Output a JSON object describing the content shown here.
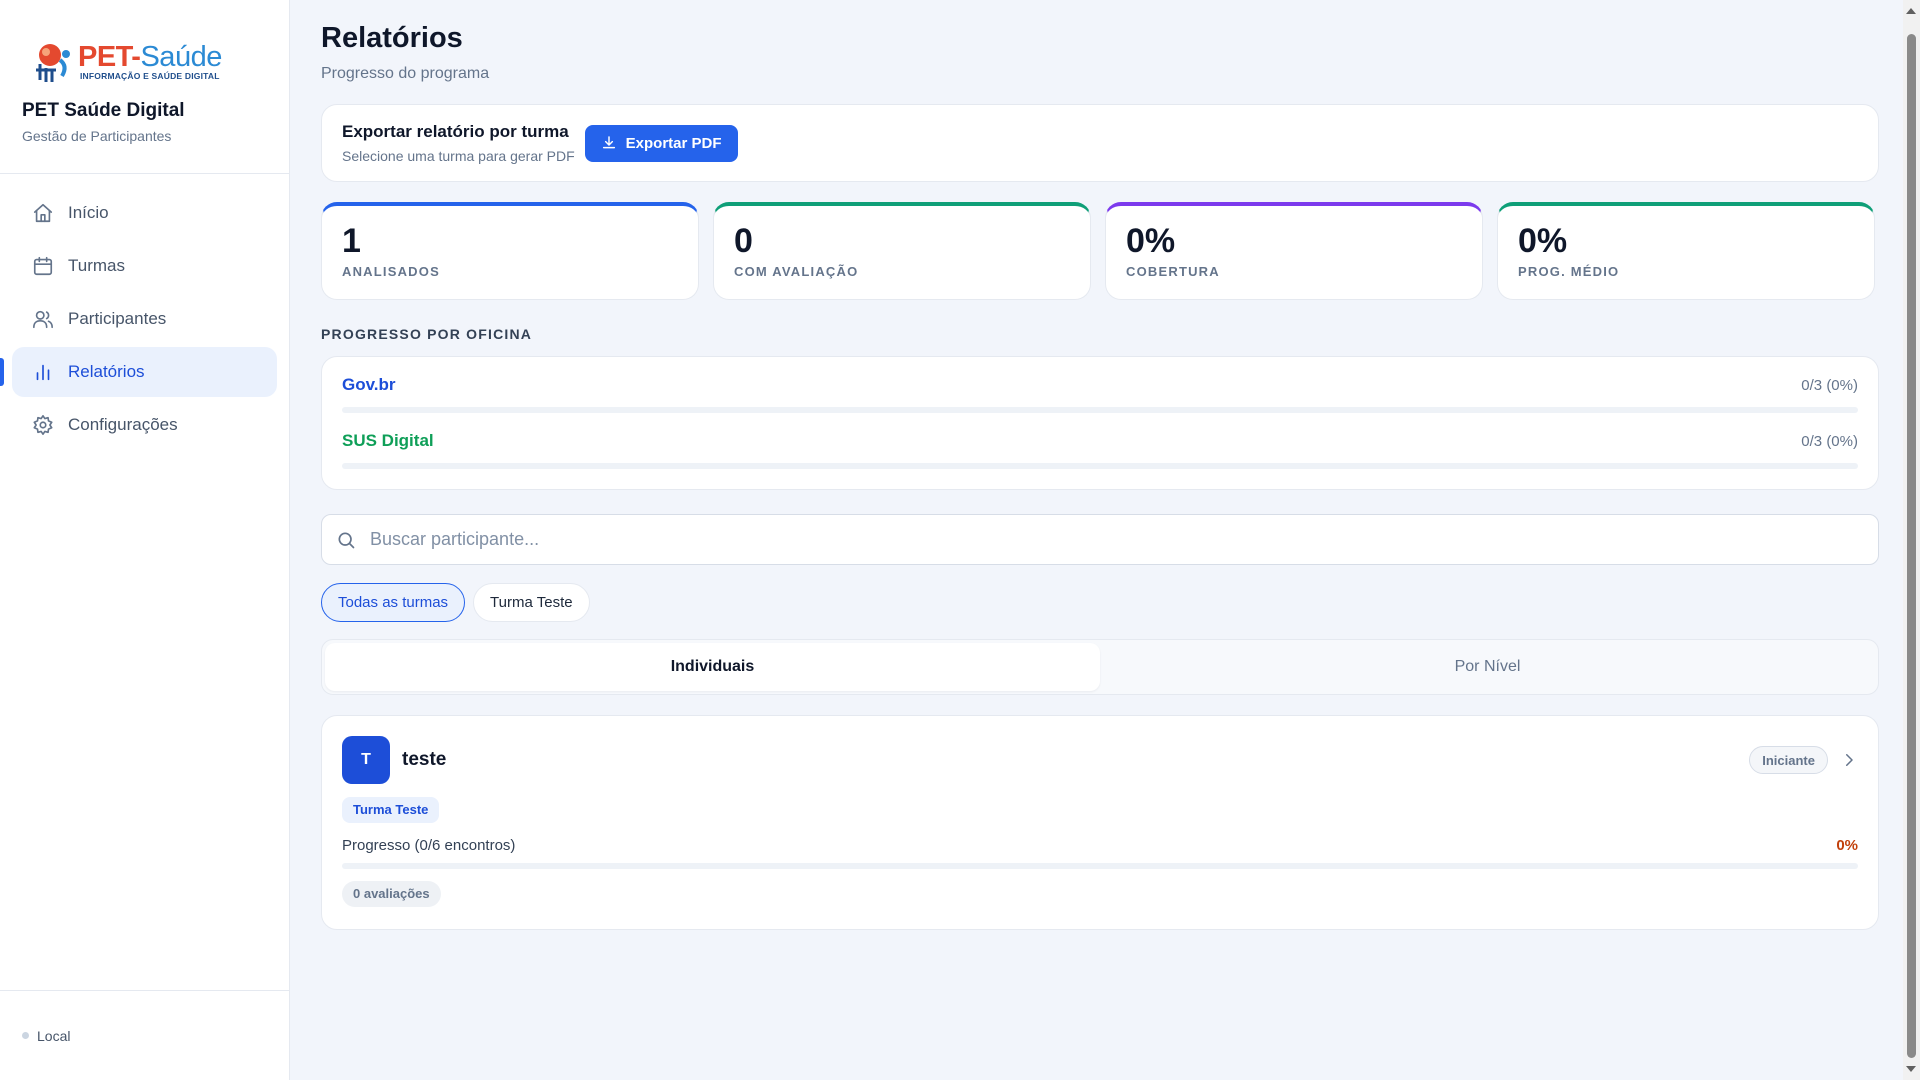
{
  "brand": {
    "logo_pet": "PET-",
    "logo_saude": "Saúde",
    "logo_sub": "INFORMAÇÃO E SAÚDE DIGITAL",
    "app_name": "PET Saúde Digital",
    "app_sub": "Gestão de Participantes"
  },
  "nav": {
    "items": [
      {
        "label": "Início",
        "icon": "home-icon"
      },
      {
        "label": "Turmas",
        "icon": "calendar-icon"
      },
      {
        "label": "Participantes",
        "icon": "users-icon"
      },
      {
        "label": "Relatórios",
        "icon": "bar-chart-icon",
        "active": true
      },
      {
        "label": "Configurações",
        "icon": "gear-icon"
      }
    ]
  },
  "footer": {
    "status": "Local"
  },
  "header": {
    "title": "Relatórios",
    "subtitle": "Progresso do programa"
  },
  "export": {
    "title": "Exportar relatório por turma",
    "subtitle": "Selecione uma turma para gerar PDF",
    "button_label": "Exportar PDF"
  },
  "stats": [
    {
      "value": "1",
      "label": "ANALISADOS",
      "color": "#2563eb"
    },
    {
      "value": "0",
      "label": "COM AVALIAÇÃO",
      "color": "#0f9f78"
    },
    {
      "value": "0%",
      "label": "COBERTURA",
      "color": "#7c3aed"
    },
    {
      "value": "0%",
      "label": "PROG. MÉDIO",
      "color": "#0f9f78"
    }
  ],
  "oficinas": {
    "section_label": "PROGRESSO POR OFICINA",
    "items": [
      {
        "name": "Gov.br",
        "count": "0/3 (0%)",
        "color": "#1d4ed8",
        "progress": 0
      },
      {
        "name": "SUS Digital",
        "count": "0/3 (0%)",
        "color": "#0f9f58",
        "progress": 0
      }
    ]
  },
  "search": {
    "placeholder": "Buscar participante..."
  },
  "filters": [
    {
      "label": "Todas as turmas",
      "active": true
    },
    {
      "label": "Turma Teste",
      "active": false
    }
  ],
  "tabs": [
    {
      "label": "Individuais",
      "active": true
    },
    {
      "label": "Por Nível",
      "active": false
    }
  ],
  "participant": {
    "initial": "T",
    "name": "teste",
    "level": "Iniciante",
    "turma": "Turma Teste",
    "progress_label": "Progresso (0/6 encontros)",
    "progress_pct": "0%",
    "progress": 0,
    "evaluations": "0 avaliações"
  }
}
